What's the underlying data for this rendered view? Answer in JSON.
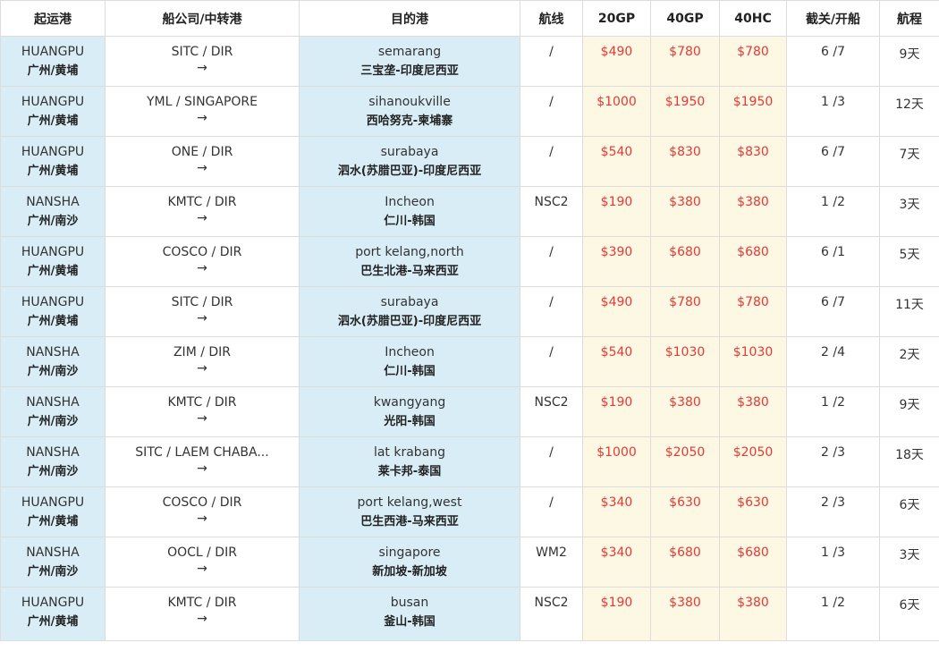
{
  "headers": [
    "起运港",
    "船公司/中转港",
    "目的港",
    "航线",
    "20GP",
    "40GP",
    "40HC",
    "截关/开船",
    "航程"
  ],
  "rows": [
    {
      "origin_en": "HUANGPU",
      "origin_cn": "广州/黄埔",
      "carrier": "SITC / DIR",
      "arrow": "→",
      "dest_en": "semarang",
      "dest_cn": "三宝垄-印度尼西亚",
      "route": "/",
      "p20": "$490",
      "p40": "$780",
      "p40hc": "$780",
      "schedule": "6 /7",
      "transit": "9天"
    },
    {
      "origin_en": "HUANGPU",
      "origin_cn": "广州/黄埔",
      "carrier": "YML / SINGAPORE",
      "arrow": "→",
      "dest_en": "sihanoukville",
      "dest_cn": "西哈努克-柬埔寨",
      "route": "/",
      "p20": "$1000",
      "p40": "$1950",
      "p40hc": "$1950",
      "schedule": "1 /3",
      "transit": "12天"
    },
    {
      "origin_en": "HUANGPU",
      "origin_cn": "广州/黄埔",
      "carrier": "ONE / DIR",
      "arrow": "→",
      "dest_en": "surabaya",
      "dest_cn": "泗水(苏腊巴亚)-印度尼西亚",
      "route": "/",
      "p20": "$540",
      "p40": "$830",
      "p40hc": "$830",
      "schedule": "6 /7",
      "transit": "7天"
    },
    {
      "origin_en": "NANSHA",
      "origin_cn": "广州/南沙",
      "carrier": "KMTC / DIR",
      "arrow": "→",
      "dest_en": "Incheon",
      "dest_cn": "仁川-韩国",
      "route": "NSC2",
      "p20": "$190",
      "p40": "$380",
      "p40hc": "$380",
      "schedule": "1 /2",
      "transit": "3天"
    },
    {
      "origin_en": "HUANGPU",
      "origin_cn": "广州/黄埔",
      "carrier": "COSCO / DIR",
      "arrow": "→",
      "dest_en": "port kelang,north",
      "dest_cn": "巴生北港-马来西亚",
      "route": "/",
      "p20": "$390",
      "p40": "$680",
      "p40hc": "$680",
      "schedule": "6 /1",
      "transit": "5天"
    },
    {
      "origin_en": "HUANGPU",
      "origin_cn": "广州/黄埔",
      "carrier": "SITC / DIR",
      "arrow": "→",
      "dest_en": "surabaya",
      "dest_cn": "泗水(苏腊巴亚)-印度尼西亚",
      "route": "/",
      "p20": "$490",
      "p40": "$780",
      "p40hc": "$780",
      "schedule": "6 /7",
      "transit": "11天"
    },
    {
      "origin_en": "NANSHA",
      "origin_cn": "广州/南沙",
      "carrier": "ZIM / DIR",
      "arrow": "→",
      "dest_en": "Incheon",
      "dest_cn": "仁川-韩国",
      "route": "/",
      "p20": "$540",
      "p40": "$1030",
      "p40hc": "$1030",
      "schedule": "2 /4",
      "transit": "2天"
    },
    {
      "origin_en": "NANSHA",
      "origin_cn": "广州/南沙",
      "carrier": "KMTC / DIR",
      "arrow": "→",
      "dest_en": "kwangyang",
      "dest_cn": "光阳-韩国",
      "route": "NSC2",
      "p20": "$190",
      "p40": "$380",
      "p40hc": "$380",
      "schedule": "1 /2",
      "transit": "9天"
    },
    {
      "origin_en": "NANSHA",
      "origin_cn": "广州/南沙",
      "carrier": "SITC / LAEM CHABA...",
      "arrow": "→",
      "dest_en": "lat krabang",
      "dest_cn": "莱卡邦-泰国",
      "route": "/",
      "p20": "$1000",
      "p40": "$2050",
      "p40hc": "$2050",
      "schedule": "2 /3",
      "transit": "18天"
    },
    {
      "origin_en": "HUANGPU",
      "origin_cn": "广州/黄埔",
      "carrier": "COSCO / DIR",
      "arrow": "→",
      "dest_en": "port kelang,west",
      "dest_cn": "巴生西港-马来西亚",
      "route": "/",
      "p20": "$340",
      "p40": "$630",
      "p40hc": "$630",
      "schedule": "2 /3",
      "transit": "6天"
    },
    {
      "origin_en": "NANSHA",
      "origin_cn": "广州/南沙",
      "carrier": "OOCL / DIR",
      "arrow": "→",
      "dest_en": "singapore",
      "dest_cn": "新加坡-新加坡",
      "route": "WM2",
      "p20": "$340",
      "p40": "$680",
      "p40hc": "$680",
      "schedule": "1 /3",
      "transit": "3天"
    },
    {
      "origin_en": "HUANGPU",
      "origin_cn": "广州/黄埔",
      "carrier": "KMTC / DIR",
      "arrow": "→",
      "dest_en": "busan",
      "dest_cn": "釜山-韩国",
      "route": "NSC2",
      "p20": "$190",
      "p40": "$380",
      "p40hc": "$380",
      "schedule": "1 /2",
      "transit": "6天"
    }
  ]
}
